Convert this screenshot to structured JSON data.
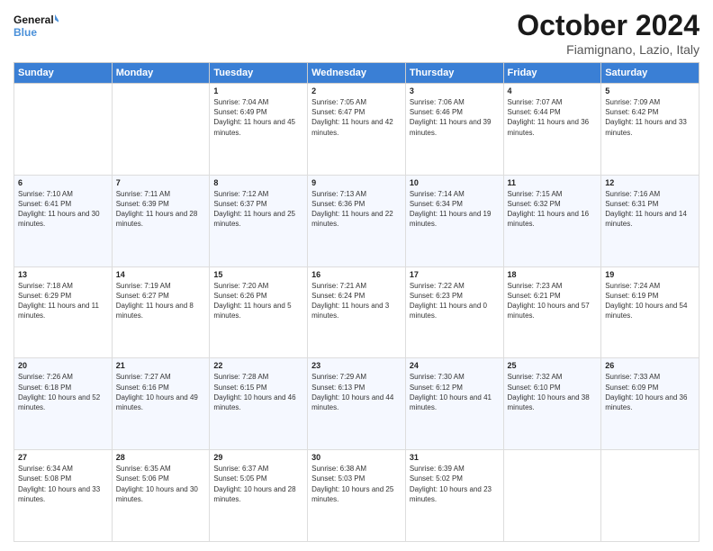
{
  "header": {
    "logo_line1": "General",
    "logo_line2": "Blue",
    "title": "October 2024",
    "subtitle": "Fiamignano, Lazio, Italy"
  },
  "days_of_week": [
    "Sunday",
    "Monday",
    "Tuesday",
    "Wednesday",
    "Thursday",
    "Friday",
    "Saturday"
  ],
  "weeks": [
    [
      {
        "day": "",
        "sunrise": "",
        "sunset": "",
        "daylight": ""
      },
      {
        "day": "",
        "sunrise": "",
        "sunset": "",
        "daylight": ""
      },
      {
        "day": "1",
        "sunrise": "Sunrise: 7:04 AM",
        "sunset": "Sunset: 6:49 PM",
        "daylight": "Daylight: 11 hours and 45 minutes."
      },
      {
        "day": "2",
        "sunrise": "Sunrise: 7:05 AM",
        "sunset": "Sunset: 6:47 PM",
        "daylight": "Daylight: 11 hours and 42 minutes."
      },
      {
        "day": "3",
        "sunrise": "Sunrise: 7:06 AM",
        "sunset": "Sunset: 6:46 PM",
        "daylight": "Daylight: 11 hours and 39 minutes."
      },
      {
        "day": "4",
        "sunrise": "Sunrise: 7:07 AM",
        "sunset": "Sunset: 6:44 PM",
        "daylight": "Daylight: 11 hours and 36 minutes."
      },
      {
        "day": "5",
        "sunrise": "Sunrise: 7:09 AM",
        "sunset": "Sunset: 6:42 PM",
        "daylight": "Daylight: 11 hours and 33 minutes."
      }
    ],
    [
      {
        "day": "6",
        "sunrise": "Sunrise: 7:10 AM",
        "sunset": "Sunset: 6:41 PM",
        "daylight": "Daylight: 11 hours and 30 minutes."
      },
      {
        "day": "7",
        "sunrise": "Sunrise: 7:11 AM",
        "sunset": "Sunset: 6:39 PM",
        "daylight": "Daylight: 11 hours and 28 minutes."
      },
      {
        "day": "8",
        "sunrise": "Sunrise: 7:12 AM",
        "sunset": "Sunset: 6:37 PM",
        "daylight": "Daylight: 11 hours and 25 minutes."
      },
      {
        "day": "9",
        "sunrise": "Sunrise: 7:13 AM",
        "sunset": "Sunset: 6:36 PM",
        "daylight": "Daylight: 11 hours and 22 minutes."
      },
      {
        "day": "10",
        "sunrise": "Sunrise: 7:14 AM",
        "sunset": "Sunset: 6:34 PM",
        "daylight": "Daylight: 11 hours and 19 minutes."
      },
      {
        "day": "11",
        "sunrise": "Sunrise: 7:15 AM",
        "sunset": "Sunset: 6:32 PM",
        "daylight": "Daylight: 11 hours and 16 minutes."
      },
      {
        "day": "12",
        "sunrise": "Sunrise: 7:16 AM",
        "sunset": "Sunset: 6:31 PM",
        "daylight": "Daylight: 11 hours and 14 minutes."
      }
    ],
    [
      {
        "day": "13",
        "sunrise": "Sunrise: 7:18 AM",
        "sunset": "Sunset: 6:29 PM",
        "daylight": "Daylight: 11 hours and 11 minutes."
      },
      {
        "day": "14",
        "sunrise": "Sunrise: 7:19 AM",
        "sunset": "Sunset: 6:27 PM",
        "daylight": "Daylight: 11 hours and 8 minutes."
      },
      {
        "day": "15",
        "sunrise": "Sunrise: 7:20 AM",
        "sunset": "Sunset: 6:26 PM",
        "daylight": "Daylight: 11 hours and 5 minutes."
      },
      {
        "day": "16",
        "sunrise": "Sunrise: 7:21 AM",
        "sunset": "Sunset: 6:24 PM",
        "daylight": "Daylight: 11 hours and 3 minutes."
      },
      {
        "day": "17",
        "sunrise": "Sunrise: 7:22 AM",
        "sunset": "Sunset: 6:23 PM",
        "daylight": "Daylight: 11 hours and 0 minutes."
      },
      {
        "day": "18",
        "sunrise": "Sunrise: 7:23 AM",
        "sunset": "Sunset: 6:21 PM",
        "daylight": "Daylight: 10 hours and 57 minutes."
      },
      {
        "day": "19",
        "sunrise": "Sunrise: 7:24 AM",
        "sunset": "Sunset: 6:19 PM",
        "daylight": "Daylight: 10 hours and 54 minutes."
      }
    ],
    [
      {
        "day": "20",
        "sunrise": "Sunrise: 7:26 AM",
        "sunset": "Sunset: 6:18 PM",
        "daylight": "Daylight: 10 hours and 52 minutes."
      },
      {
        "day": "21",
        "sunrise": "Sunrise: 7:27 AM",
        "sunset": "Sunset: 6:16 PM",
        "daylight": "Daylight: 10 hours and 49 minutes."
      },
      {
        "day": "22",
        "sunrise": "Sunrise: 7:28 AM",
        "sunset": "Sunset: 6:15 PM",
        "daylight": "Daylight: 10 hours and 46 minutes."
      },
      {
        "day": "23",
        "sunrise": "Sunrise: 7:29 AM",
        "sunset": "Sunset: 6:13 PM",
        "daylight": "Daylight: 10 hours and 44 minutes."
      },
      {
        "day": "24",
        "sunrise": "Sunrise: 7:30 AM",
        "sunset": "Sunset: 6:12 PM",
        "daylight": "Daylight: 10 hours and 41 minutes."
      },
      {
        "day": "25",
        "sunrise": "Sunrise: 7:32 AM",
        "sunset": "Sunset: 6:10 PM",
        "daylight": "Daylight: 10 hours and 38 minutes."
      },
      {
        "day": "26",
        "sunrise": "Sunrise: 7:33 AM",
        "sunset": "Sunset: 6:09 PM",
        "daylight": "Daylight: 10 hours and 36 minutes."
      }
    ],
    [
      {
        "day": "27",
        "sunrise": "Sunrise: 6:34 AM",
        "sunset": "Sunset: 5:08 PM",
        "daylight": "Daylight: 10 hours and 33 minutes."
      },
      {
        "day": "28",
        "sunrise": "Sunrise: 6:35 AM",
        "sunset": "Sunset: 5:06 PM",
        "daylight": "Daylight: 10 hours and 30 minutes."
      },
      {
        "day": "29",
        "sunrise": "Sunrise: 6:37 AM",
        "sunset": "Sunset: 5:05 PM",
        "daylight": "Daylight: 10 hours and 28 minutes."
      },
      {
        "day": "30",
        "sunrise": "Sunrise: 6:38 AM",
        "sunset": "Sunset: 5:03 PM",
        "daylight": "Daylight: 10 hours and 25 minutes."
      },
      {
        "day": "31",
        "sunrise": "Sunrise: 6:39 AM",
        "sunset": "Sunset: 5:02 PM",
        "daylight": "Daylight: 10 hours and 23 minutes."
      },
      {
        "day": "",
        "sunrise": "",
        "sunset": "",
        "daylight": ""
      },
      {
        "day": "",
        "sunrise": "",
        "sunset": "",
        "daylight": ""
      }
    ]
  ]
}
